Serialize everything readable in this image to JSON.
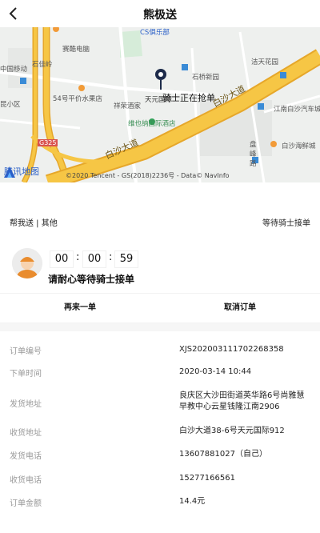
{
  "header": {
    "title": "熊极送"
  },
  "map": {
    "labels": {
      "cs_club": "CS俱乐部",
      "saiqu": "赛酷电脑",
      "shijiling": "石佳岭",
      "mobile": "中国移动",
      "fruit": "54号平价水果店",
      "xiangrong": "祥荣酒家",
      "vietnam": "维也纳国际酒店",
      "tianyuan": "天元国际",
      "shiqiao": "石桥新园",
      "jietian": "洁天花园",
      "jiangnan": "江南白沙汽车城",
      "baisha_hai": "白沙海鲜城",
      "panjiang": "盘峰路",
      "xiaoqu": "昆小区",
      "g325": "G325",
      "road_a": "白沙大道",
      "road_b": "白沙大道"
    },
    "rider_tip": "骑士正在抢单",
    "copyright": "©2020 Tencent - GS(2018)2236号 - Data© NavInfo",
    "logo_text": "腾讯地图"
  },
  "order": {
    "type": "帮我送 | 其他",
    "status": "等待骑士接单",
    "timer": {
      "hours": "00",
      "minutes": "00",
      "seconds": "59"
    },
    "wait_message": "请耐心等待骑士接单"
  },
  "actions": {
    "reorder": "再来一单",
    "cancel": "取消订单"
  },
  "details": [
    {
      "key": "订单编号",
      "value": "XJS202003111702268358"
    },
    {
      "key": "下单时间",
      "value": "2020-03-14 10:44"
    },
    {
      "key": "发货地址",
      "value": "良庆区大沙田街道英华路6号尚雅慧早教中心云星钱隆江南2906"
    },
    {
      "key": "收货地址",
      "value": "白沙大道38-6号天元国际912"
    },
    {
      "key": "发货电话",
      "value": "13607881027（自己）"
    },
    {
      "key": "收货电话",
      "value": "15277166561"
    },
    {
      "key": "订单金额",
      "value": "14.4元"
    }
  ],
  "colors": {
    "road": "#f6c645",
    "road_dark": "#e6a72a",
    "pin": "#1d2b4a",
    "accent_blue": "#2a5fc8"
  }
}
